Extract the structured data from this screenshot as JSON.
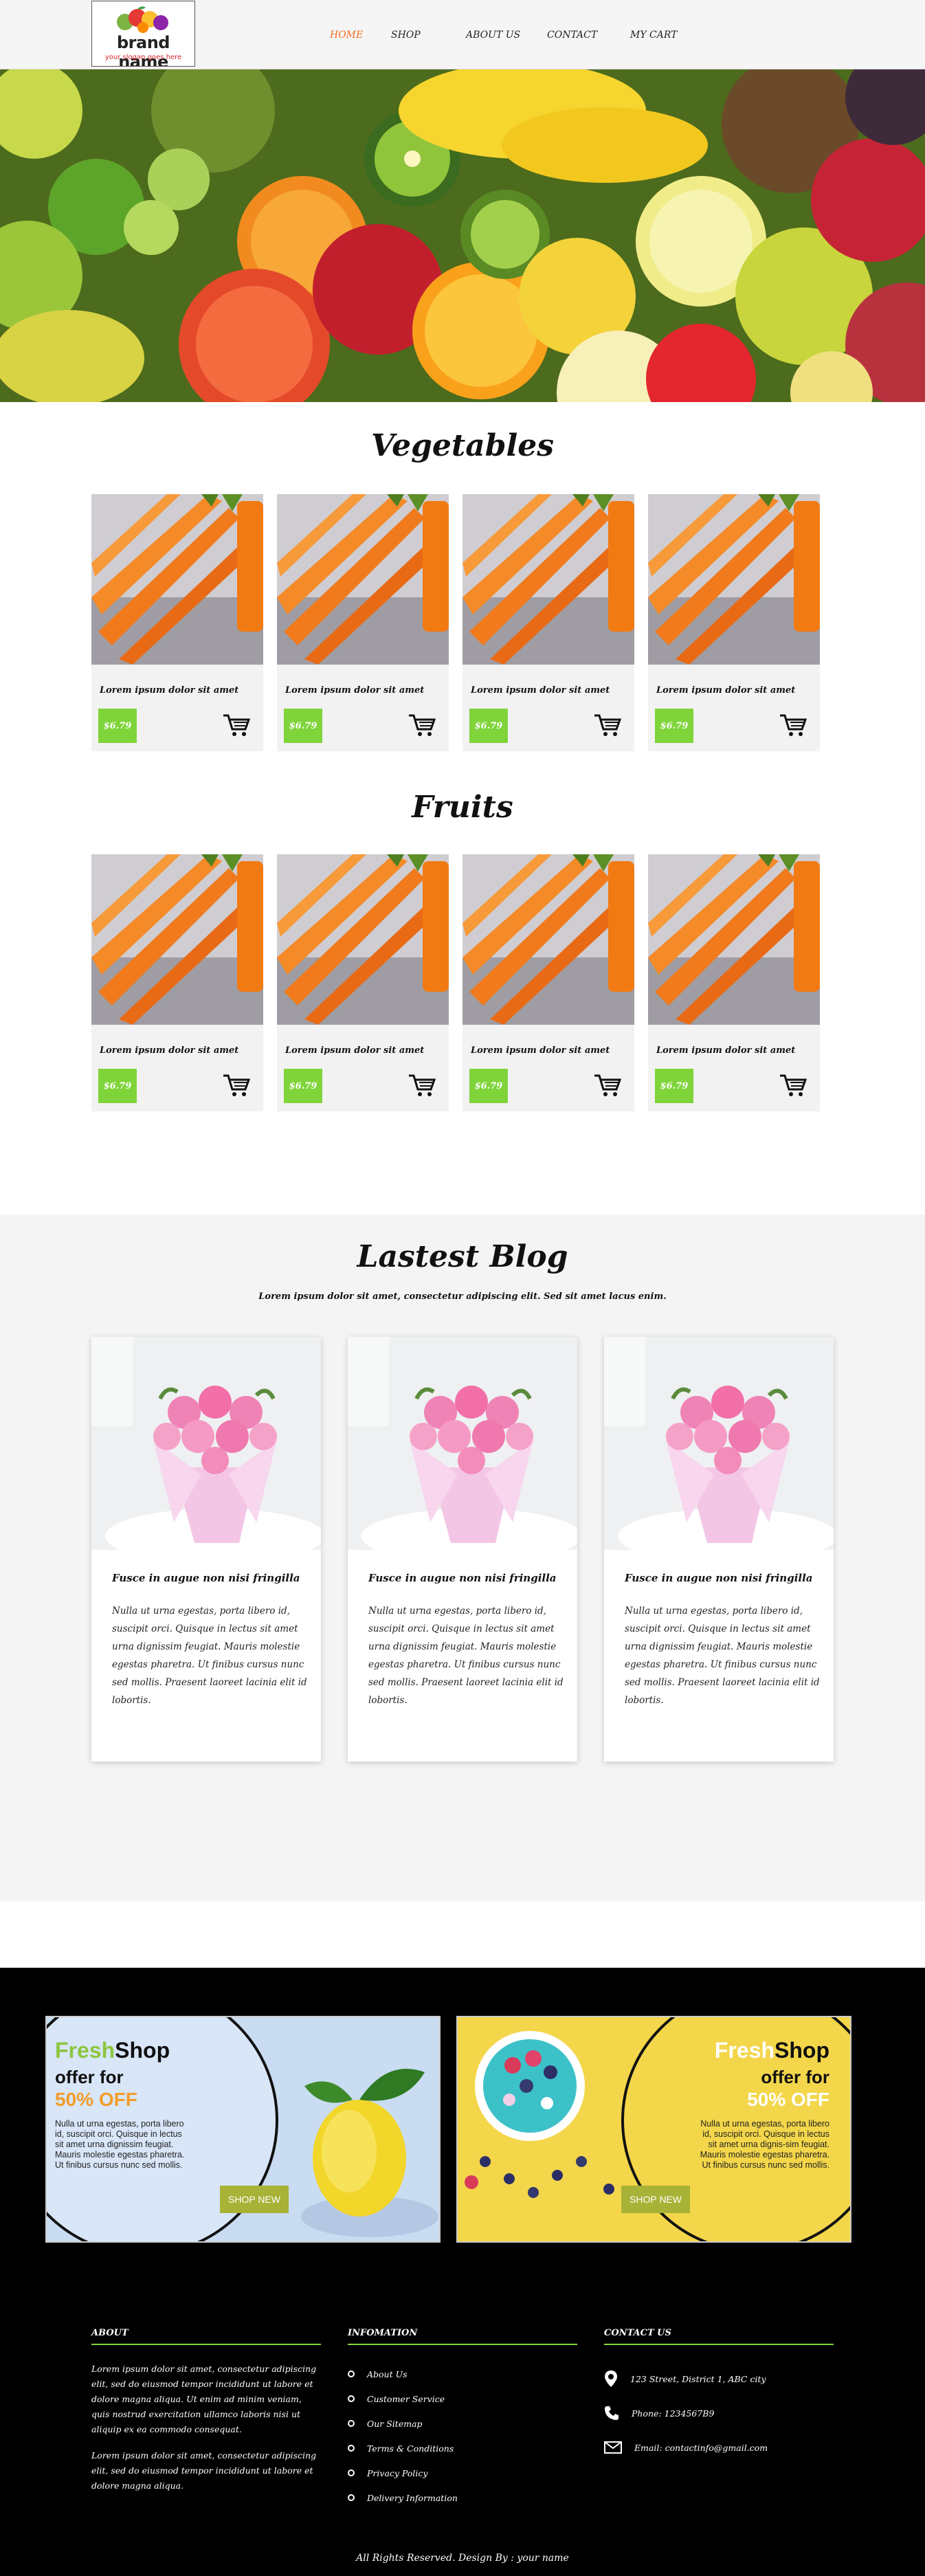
{
  "header": {
    "brand_name": "brand name",
    "slogan": "your slogan goes here",
    "nav": [
      "HOME",
      "SHOP",
      "ABOUT US",
      "CONTACT",
      "MY CART"
    ]
  },
  "sections": {
    "vegetables_title": "Vegetables",
    "fruits_title": "Fruits"
  },
  "vegetables": [
    {
      "name": "Lorem ipsum dolor sit amet",
      "price": "$6.79"
    },
    {
      "name": "Lorem ipsum dolor sit amet",
      "price": "$6.79"
    },
    {
      "name": "Lorem ipsum dolor sit amet",
      "price": "$6.79"
    },
    {
      "name": "Lorem ipsum dolor sit amet",
      "price": "$6.79"
    }
  ],
  "fruits": [
    {
      "name": "Lorem ipsum dolor sit amet",
      "price": "$6.79"
    },
    {
      "name": "Lorem ipsum dolor sit amet",
      "price": "$6.79"
    },
    {
      "name": "Lorem ipsum dolor sit amet",
      "price": "$6.79"
    },
    {
      "name": "Lorem ipsum dolor sit amet",
      "price": "$6.79"
    }
  ],
  "blog": {
    "title": "Lastest Blog",
    "subtitle": "Lorem ipsum dolor sit amet, consectetur adipiscing elit. Sed sit amet lacus enim.",
    "posts": [
      {
        "title": "Fusce in augue non nisi fringilla",
        "text": "Nulla ut urna egestas, porta libero id, suscipit orci. Quisque in lectus sit amet urna dignissim feugiat. Mauris molestie egestas pharetra. Ut finibus cursus nunc sed mollis. Praesent laoreet lacinia elit id lobortis."
      },
      {
        "title": "Fusce in augue non nisi fringilla",
        "text": "Nulla ut urna egestas, porta libero id, suscipit orci. Quisque in lectus sit amet urna dignissim feugiat. Mauris molestie egestas pharetra. Ut finibus cursus nunc sed mollis. Praesent laoreet lacinia elit id lobortis."
      },
      {
        "title": "Fusce in augue non nisi fringilla",
        "text": "Nulla ut urna egestas, porta libero id, suscipit orci. Quisque in lectus sit amet urna dignissim feugiat. Mauris molestie egestas pharetra. Ut finibus cursus nunc sed mollis. Praesent laoreet lacinia elit id lobortis."
      }
    ]
  },
  "promos": [
    {
      "brand_a": "Fresh",
      "brand_b": "Shop",
      "offer": "offer for",
      "discount": "50% OFF",
      "text": "Nulla ut urna egestas, porta libero id, suscipit orci. Quisque in lectus sit amet urna dignissim feugiat. Mauris molestie egestas pharetra. Ut finibus cursus nunc sed mollis.",
      "button": "SHOP NEW"
    },
    {
      "brand_a": "Fresh",
      "brand_b": "Shop",
      "offer": "offer for",
      "discount": "50% OFF",
      "text": "Nulla ut urna egestas, porta libero id, suscipit orci. Quisque in lectus sit amet urna dignis-sim feugiat. Mauris molestie egestas pharetra. Ut finibus cursus nunc sed mollis.",
      "button": "SHOP NEW"
    }
  ],
  "footer": {
    "about_title": "ABOUT",
    "about_p1": "Lorem ipsum dolor sit amet, consectetur adipiscing elit, sed do eiusmod tempor incididunt ut labore et dolore magna aliqua. Ut enim ad minim veniam, quis nostrud exercitation ullamco laboris nisi ut aliquip ex ea commodo consequat.",
    "about_p2": "Lorem ipsum dolor sit amet, consectetur adipiscing elit, sed do eiusmod tempor incididunt ut labore et dolore magna aliqua.",
    "info_title": "INFOMATION",
    "info_links": [
      "About Us",
      "Customer Service",
      "Our Sitemap",
      "Terms & Conditions",
      "Privacy Policy",
      "Delivery Information"
    ],
    "contact_title": "CONTACT US",
    "address": "123 Street, District 1, ABC city",
    "phone": "Phone: 1234567B9",
    "email": "Email: contactinfo@gmail.com",
    "copyright": "All Rights Reserved. Design By : your name"
  },
  "colors": {
    "accent_green": "#7fd43a",
    "nav_active": "#f26d21",
    "promo_green": "#8cc63f",
    "promo_orange": "#f39c2a"
  }
}
